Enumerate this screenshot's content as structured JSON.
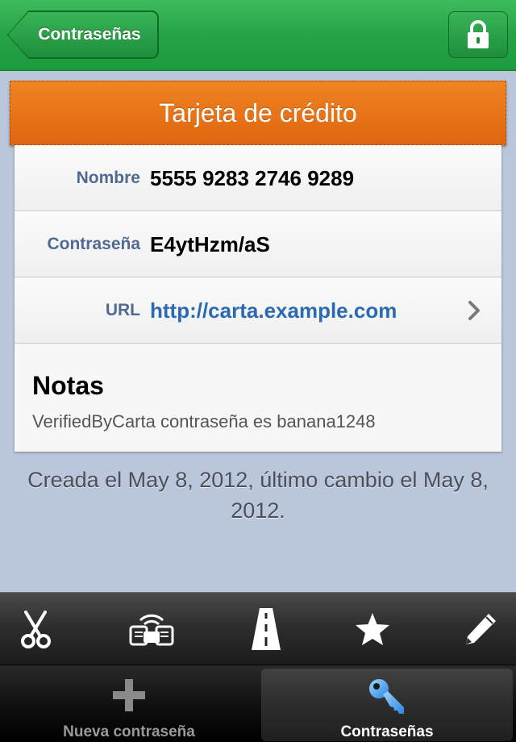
{
  "navbar": {
    "back_label": "Contraseñas",
    "lock_icon": "lock-icon"
  },
  "card": {
    "title": "Tarjeta de crédito",
    "header_color": "#e8741a",
    "fields": [
      {
        "label": "Nombre",
        "value": "5555 9283 2746 9289"
      },
      {
        "label": "Contraseña",
        "value": "E4ytHzm/aS"
      },
      {
        "label": "URL",
        "value": "http://carta.example.com"
      }
    ],
    "notes": {
      "title": "Notas",
      "text": "VerifiedByCarta contraseña es banana1248"
    }
  },
  "footer": {
    "text": "Creada el May 8, 2012, último cambio el May 8, 2012."
  },
  "toolbar": {
    "items": [
      {
        "icon": "scissors-icon"
      },
      {
        "icon": "wireless-sync-icon"
      },
      {
        "icon": "road-icon"
      },
      {
        "icon": "star-icon"
      },
      {
        "icon": "pencil-icon"
      }
    ]
  },
  "tabbar": {
    "tabs": [
      {
        "label": "Nueva contraseña",
        "icon": "plus-icon",
        "selected": false
      },
      {
        "label": "Contraseñas",
        "icon": "key-icon",
        "selected": true
      }
    ]
  },
  "colors": {
    "navbar_green": "#27a347",
    "link_blue": "#2a6ab0",
    "label_blue": "#506a92",
    "background": "#b9c6db"
  }
}
